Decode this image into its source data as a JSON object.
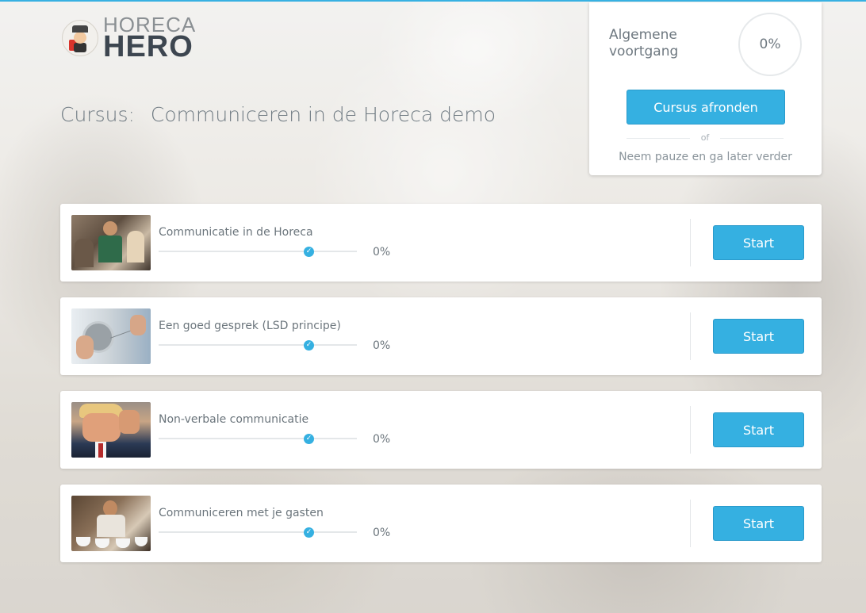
{
  "brand": {
    "logo_top": "HORECA",
    "logo_bottom": "HERO"
  },
  "course": {
    "prefix": "Cursus:",
    "title": "Communiceren in de Horeca demo"
  },
  "overall_progress": {
    "label": "Algemene voortgang",
    "value": "0%",
    "finish_button": "Cursus afronden",
    "or_text": "of",
    "pause_link": "Neem pauze en ga later verder"
  },
  "lessons": [
    {
      "title": "Communicatie in de Horeca",
      "progress": "0%",
      "button": "Start",
      "thumbnail": "waitress-serving-guests-photo"
    },
    {
      "title": "Een goed gesprek (LSD principe)",
      "progress": "0%",
      "button": "Start",
      "thumbnail": "tin-can-telephone-photo"
    },
    {
      "title": "Non-verbale communicatie",
      "progress": "0%",
      "button": "Start",
      "thumbnail": "man-hand-on-head-photo"
    },
    {
      "title": "Communiceren met je gasten",
      "progress": "0%",
      "button": "Start",
      "thumbnail": "barista-with-coffee-cups-photo"
    }
  ],
  "colors": {
    "accent": "#35b0e1",
    "text": "#6b757c"
  }
}
